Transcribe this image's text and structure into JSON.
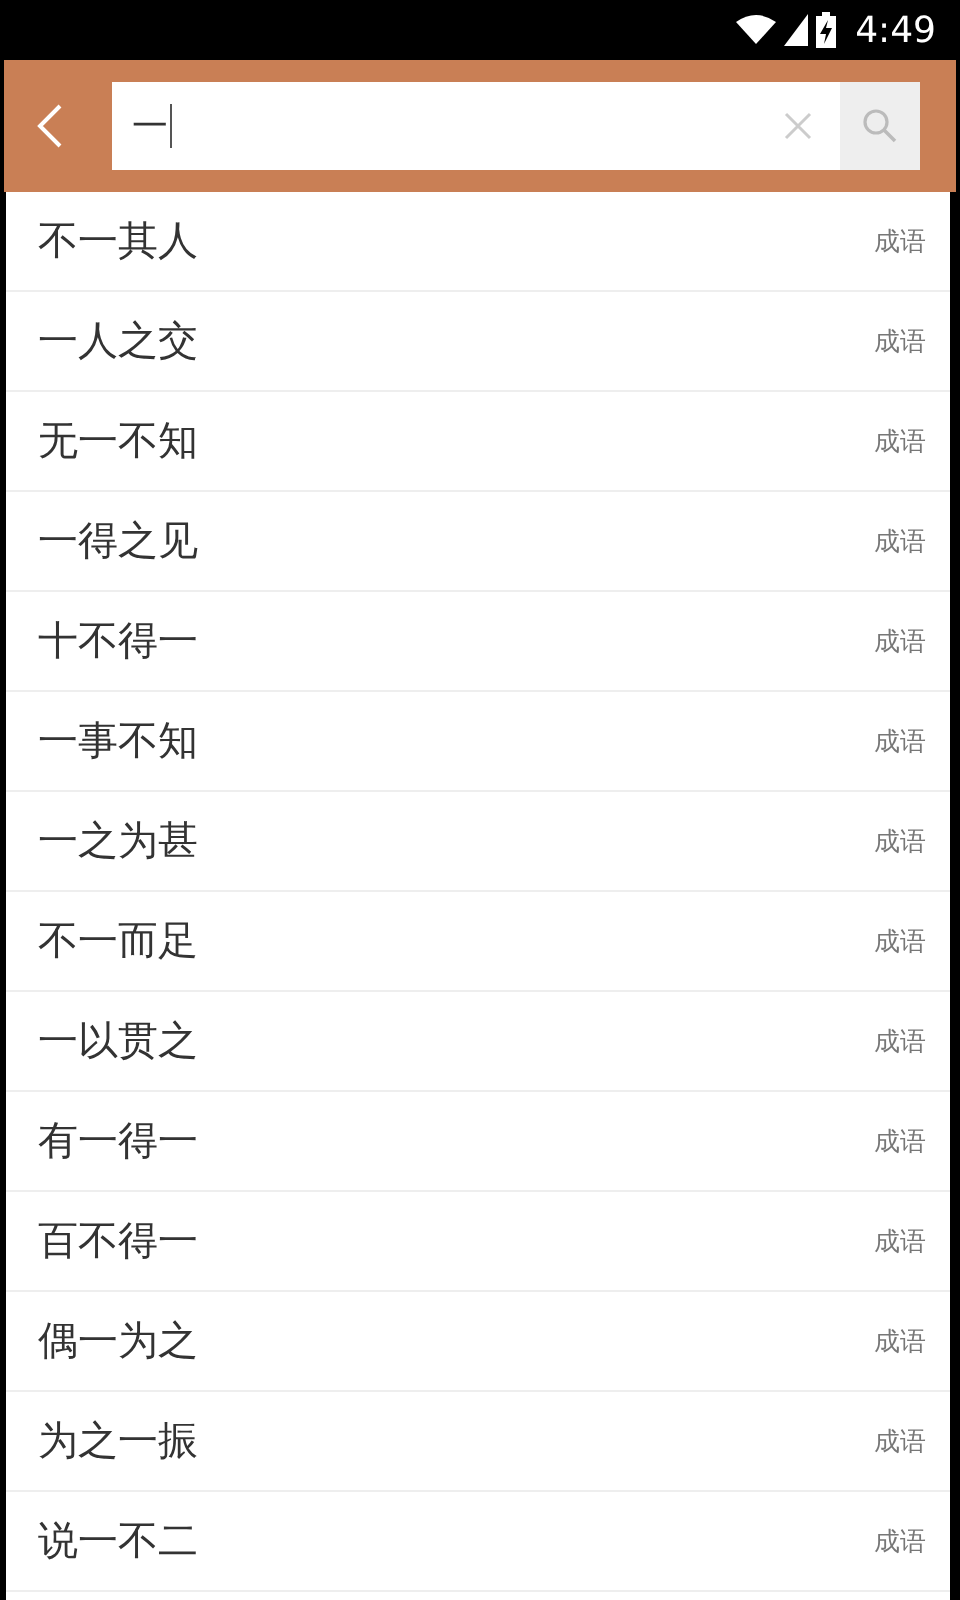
{
  "status_bar": {
    "time": "4:49"
  },
  "search": {
    "value": "一"
  },
  "results": [
    {
      "word": "不一其人",
      "tag": "成语"
    },
    {
      "word": "一人之交",
      "tag": "成语"
    },
    {
      "word": "无一不知",
      "tag": "成语"
    },
    {
      "word": "一得之见",
      "tag": "成语"
    },
    {
      "word": "十不得一",
      "tag": "成语"
    },
    {
      "word": "一事不知",
      "tag": "成语"
    },
    {
      "word": "一之为甚",
      "tag": "成语"
    },
    {
      "word": "不一而足",
      "tag": "成语"
    },
    {
      "word": "一以贯之",
      "tag": "成语"
    },
    {
      "word": "有一得一",
      "tag": "成语"
    },
    {
      "word": "百不得一",
      "tag": "成语"
    },
    {
      "word": "偶一为之",
      "tag": "成语"
    },
    {
      "word": "为之一振",
      "tag": "成语"
    },
    {
      "word": "说一不二",
      "tag": "成语"
    }
  ]
}
